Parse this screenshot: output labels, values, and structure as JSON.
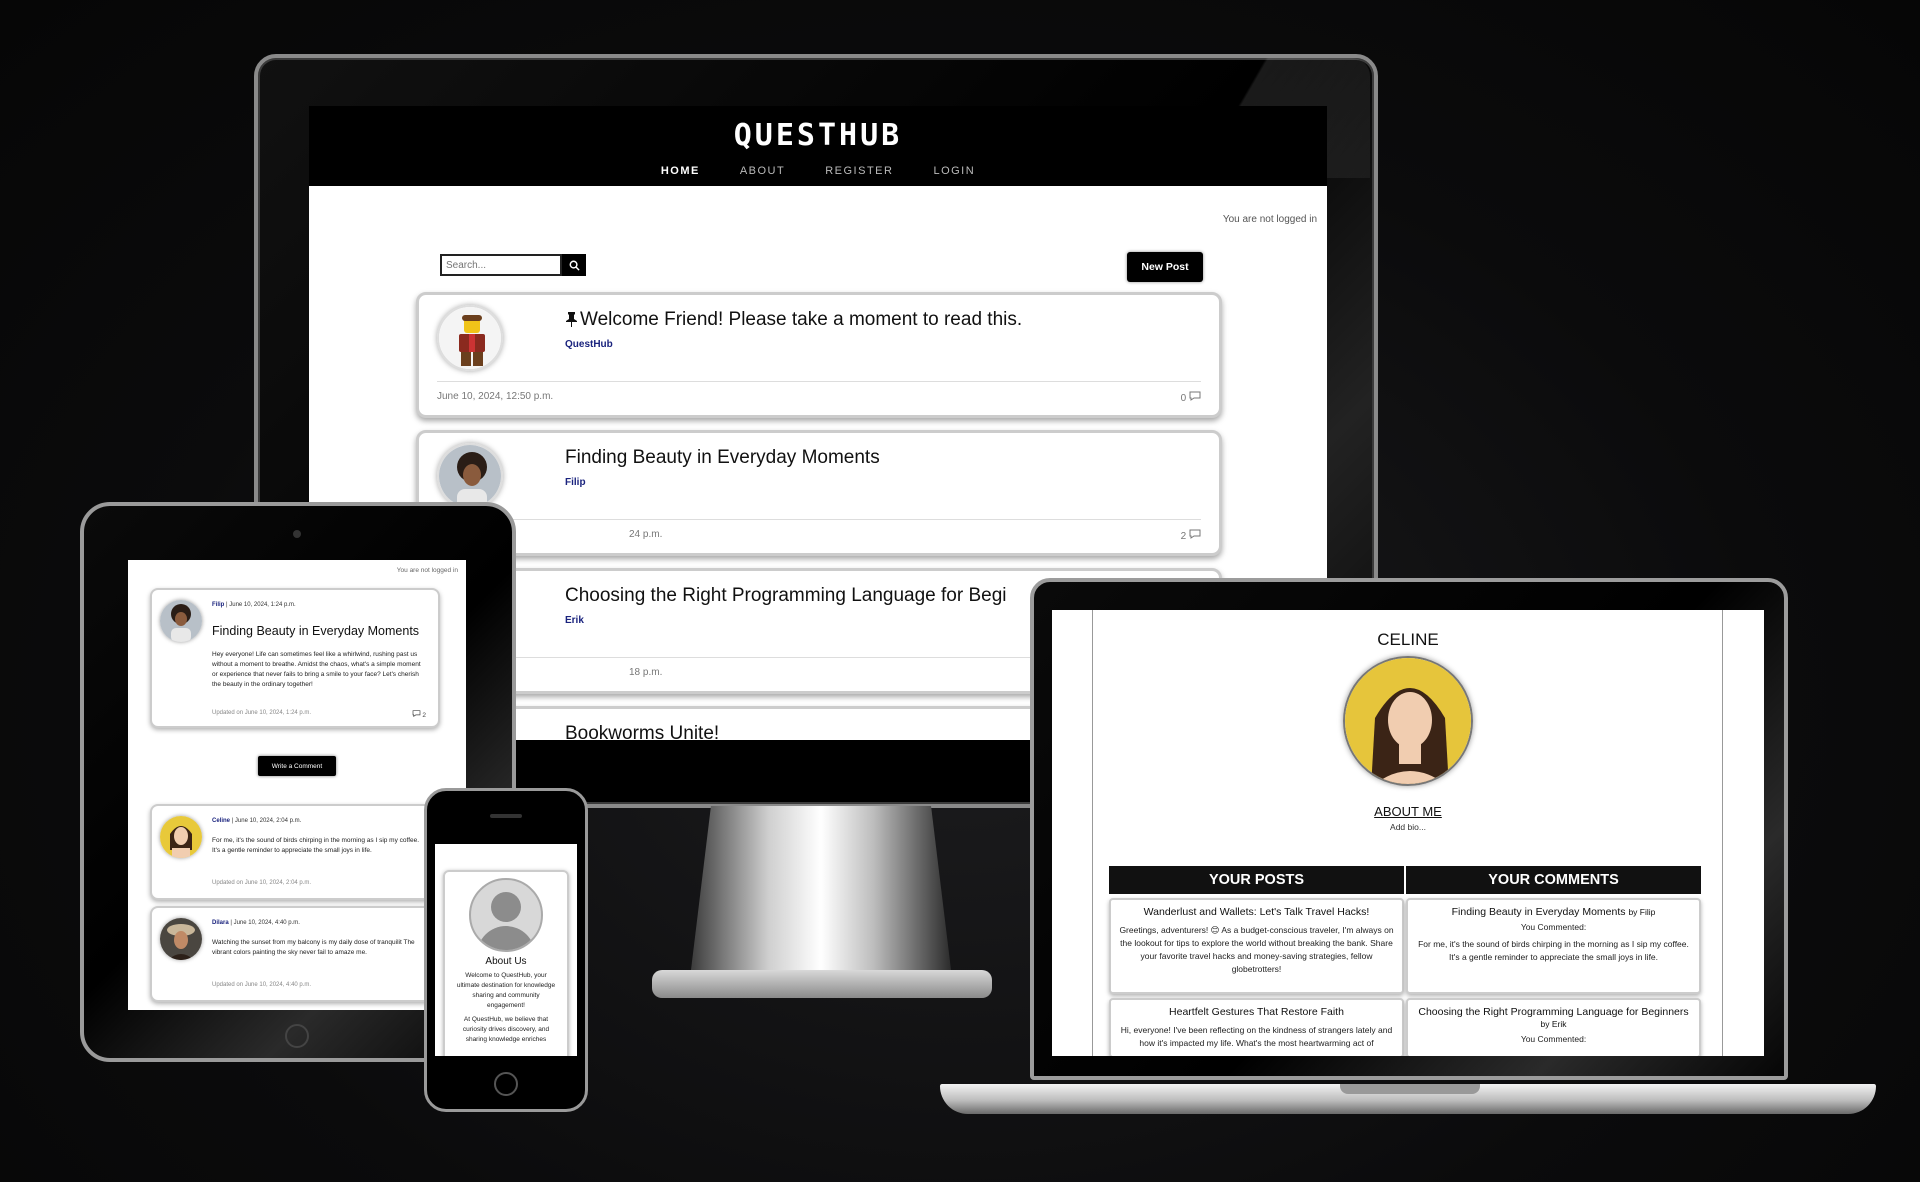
{
  "desktop": {
    "logo": "QUESTHUB",
    "nav": [
      "HOME",
      "ABOUT",
      "REGISTER",
      "LOGIN"
    ],
    "login_status": "You are not logged in",
    "search_placeholder": "Search...",
    "new_post_label": "New Post",
    "posts": [
      {
        "title": "Welcome Friend! Please take a moment to read this.",
        "author": "QuestHub",
        "date": "June 10, 2024, 12:50 p.m.",
        "comments": "0",
        "pinned": true
      },
      {
        "title": "Finding Beauty in Everyday Moments",
        "author": "Filip",
        "date": "24 p.m.",
        "comments": "2"
      },
      {
        "title": "Choosing the Right Programming Language for Begi",
        "author": "Erik",
        "date": "18 p.m."
      },
      {
        "title": "Bookworms Unite!"
      }
    ]
  },
  "tablet": {
    "login_status": "You are not logged in",
    "post": {
      "author": "Filip",
      "date": "June 10, 2024, 1:24 p.m.",
      "title": "Finding Beauty in Everyday Moments",
      "body": "Hey everyone! Life can sometimes feel like a whirlwind, rushing past us without a moment to breathe. Amidst the chaos, what's a simple moment or experience that never fails to bring a smile to your face? Let's cherish the beauty in the ordinary together!",
      "updated": "Updated on June 10, 2024, 1:24 p.m.",
      "comments": "2"
    },
    "write_comment_label": "Write a Comment",
    "comments": [
      {
        "author": "Celine",
        "date": "June 10, 2024, 2:04 p.m.",
        "body": "For me, it's the sound of birds chirping in the morning as I sip my coffee. It's a gentle reminder to appreciate the small joys in life.",
        "updated": "Updated on June 10, 2024, 2:04 p.m."
      },
      {
        "author": "Dilara",
        "date": "June 10, 2024, 4:40 p.m.",
        "body": "Watching the sunset from my balcony is my daily dose of tranquilit The vibrant colors painting the sky never fail to amaze me.",
        "updated": "Updated on June 10, 2024, 4:40 p.m."
      }
    ]
  },
  "phone": {
    "about_title": "About Us",
    "about_text_1": "Welcome to QuestHub, your ultimate destination for knowledge sharing and community engagement!",
    "about_text_2": "At QuestHub, we believe that curiosity drives discovery, and sharing knowledge enriches"
  },
  "laptop": {
    "name": "CELINE",
    "about_heading": "ABOUT ME",
    "bio": "Add bio...",
    "your_posts_heading": "YOUR POSTS",
    "your_comments_heading": "YOUR COMMENTS",
    "posts": [
      {
        "title": "Wanderlust and Wallets: Let's Talk Travel Hacks!",
        "body": "Greetings, adventurers! 😊 As a budget-conscious traveler, I'm always on the lookout for tips to explore the world without breaking the bank. Share your favorite travel hacks and money-saving strategies, fellow globetrotters!"
      },
      {
        "title": "Heartfelt Gestures That Restore Faith",
        "body": "Hi, everyone! I've been reflecting on the kindness of strangers lately and how it's impacted my life. What's the most heartwarming act of"
      }
    ],
    "comments": [
      {
        "post_title": "Finding Beauty in Everyday Moments",
        "by": "by Filip",
        "you_commented": "You Commented:",
        "body": "For me, it's the sound of birds chirping in the morning as I sip my coffee. It's a gentle reminder to appreciate the small joys in life."
      },
      {
        "post_title": "Choosing the Right Programming Language for Beginners",
        "by": "by Erik",
        "you_commented": "You Commented:"
      }
    ]
  },
  "colors": {
    "accent": "#000000",
    "author_link": "#1a237e",
    "card_border": "#cccccc"
  },
  "icons": [
    "search-icon",
    "pin-icon",
    "comment-icon"
  ]
}
